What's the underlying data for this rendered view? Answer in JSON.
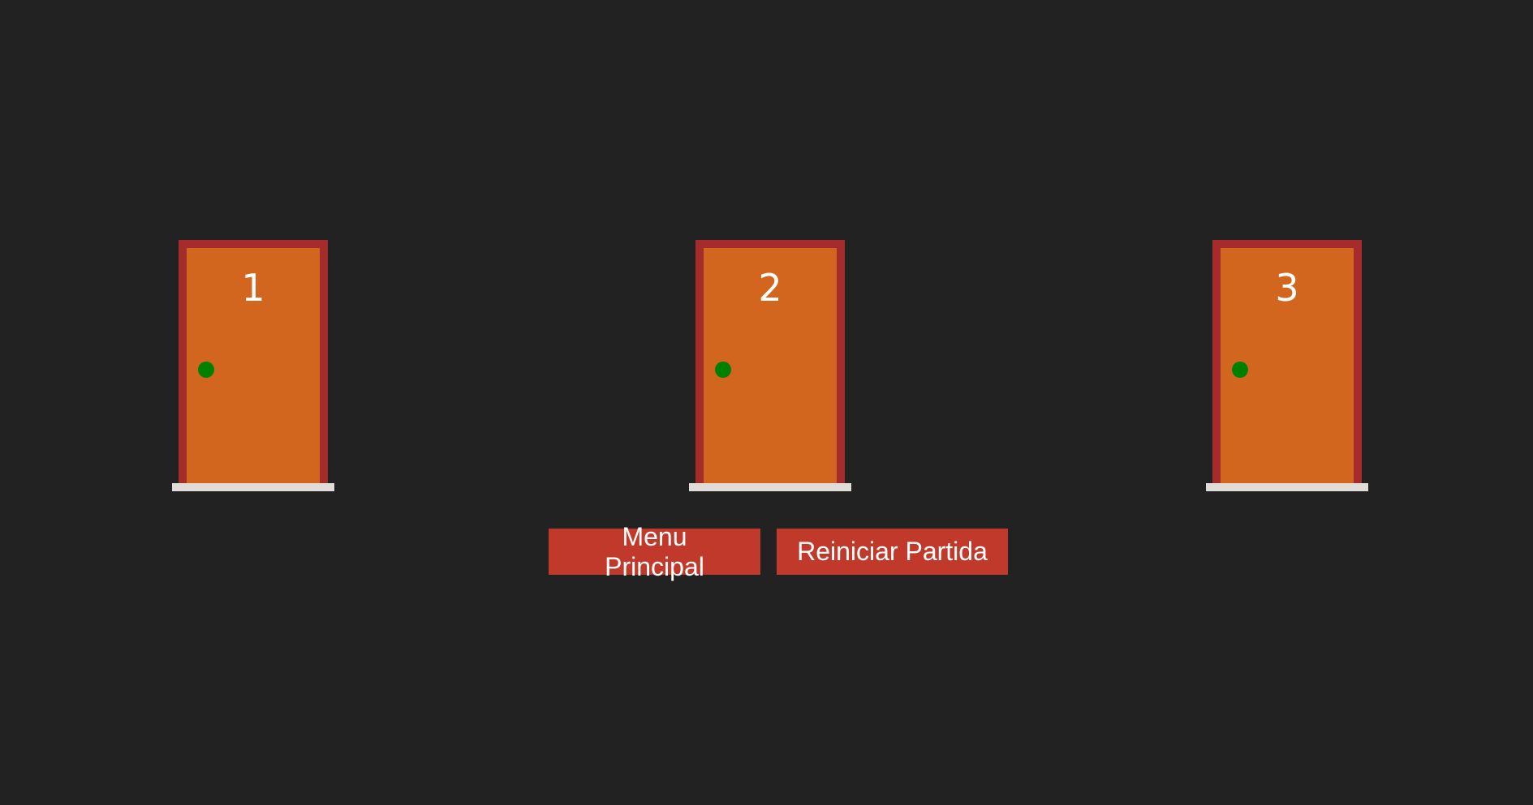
{
  "doors": [
    {
      "number": "1"
    },
    {
      "number": "2"
    },
    {
      "number": "3"
    }
  ],
  "controls": {
    "menu_label": "Menu Principal",
    "restart_label": "Reiniciar Partida"
  },
  "colors": {
    "background": "#222222",
    "door_frame": "#a62b2b",
    "door_panel": "#d2661e",
    "door_knob": "#008000",
    "threshold": "#e0dcd8",
    "button": "#c0392b",
    "text": "#ffffff"
  }
}
